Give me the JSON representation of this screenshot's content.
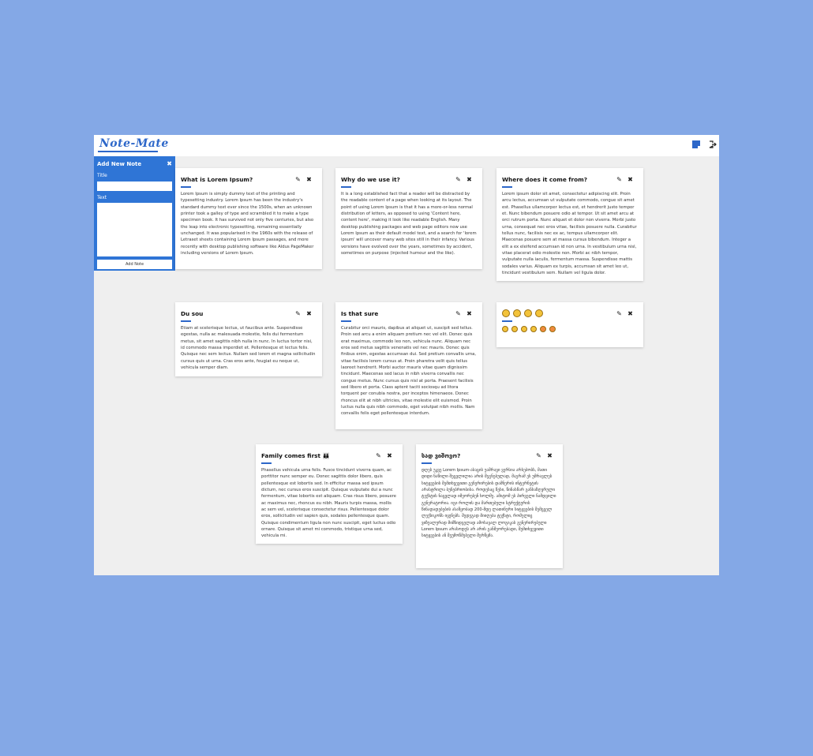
{
  "app": {
    "logo": "Note-Mate",
    "icons": {
      "new_note": "note-icon",
      "logout": "logout-icon"
    }
  },
  "sidebar": {
    "title": "Add New Note",
    "close": "✖",
    "title_label": "Title",
    "text_label": "Text",
    "title_value": "",
    "text_value": "",
    "button_label": "Add Note"
  },
  "icons": {
    "edit": "✎",
    "delete": "✖"
  },
  "notes": [
    {
      "title": "What is Lorem Ipsum?",
      "body": "Lorem Ipsum is simply dummy text of the printing and typesetting industry. Lorem Ipsum has been the industry's standard dummy text ever since the 1500s, when an unknown printer took a galley of type and scrambled it to make a type specimen book. It has survived not only five centuries, but also the leap into electronic typesetting, remaining essentially unchanged. It was popularised in the 1960s with the release of Letraset sheets containing Lorem Ipsum passages, and more recently with desktop publishing software like Aldus PageMaker including versions of Lorem Ipsum."
    },
    {
      "title": "Why do we use it?",
      "body": "It is a long established fact that a reader will be distracted by the readable content of a page when looking at its layout. The point of using Lorem Ipsum is that it has a more-or-less normal distribution of letters, as opposed to using 'Content here, content here', making it look like readable English. Many desktop publishing packages and web page editors now use Lorem Ipsum as their default model text, and a search for 'lorem ipsum' will uncover many web sites still in their infancy. Various versions have evolved over the years, sometimes by accident, sometimes on purpose (injected humour and the like)."
    },
    {
      "title": "Where does it come from?",
      "body": "Lorem ipsum dolor sit amet, consectetur adipiscing elit. Proin arcu lectus, accumsan ut vulputate commodo, congue sit amet est. Phasellus ullamcorper lectus est, et hendrerit justo tempor et. Nunc bibendum posuere odio at tempor. Ut sit amet arcu at orci rutrum porta. Nunc aliquet et dolor non viverra. Morbi justo urna, consequat nec eros vitae, facilisis posuere nulla. Curabitur tellus nunc, facilisis nec ex ac, tempus ullamcorper elit. Maecenas posuere sem at massa cursus bibendum. Integer a elit a ex eleifend accumsan id non urna. In vestibulum urna nisl, vitae placerat odio molestie non. Morbi ac nibh tempor, vulputate nulla iaculis, fermentum massa. Suspendisse mattis sodales varius. Aliquam ex turpis, accumsan sit amet leo ut, tincidunt vestibulum sem. Nullam vel ligula dolor."
    },
    {
      "title": "Du sou",
      "body": "Etiam at scelerisque lectus, ut faucibus ante. Suspendisse egestas, nulla ac malesuada molestie, felis dui fermentum metus, sit amet sagittis nibh nulla in nunc. In luctus tortor nisi, id commodo massa imperdiet et. Pellentesque et lectus felis. Quisque nec sem lectus. Nullam sed lorem et magna sollicitudin cursus quis ut urna. Cras eros ante, feugiat eu neque ut, vehicula semper diam."
    },
    {
      "title": "Is that sure",
      "body": "Curabitur orci mauris, dapibus at aliquet ut, suscipit sed tellus. Proin sed arcu a enim aliquam pretium nec vel elit. Donec quis erat maximus, commodo leo non, vehicula nunc. Aliquam nec eros sed metus sagittis venenatis vel nec mauris. Donec quis finibus enim, egestas accumsan dui. Sed pretium convallis urna, vitae facilisis lorem cursus at. Proin pharetra velit quis tellus laoreet hendrerit. Morbi auctor mauris vitae quam dignissim tincidunt. Maecenas sed lacus in nibh viverra convallis nec congue metus. Nunc cursus quis nisl at porta. Praesent facilisis sed libero et porta. Class aptent taciti sociosqu ad litora torquent per conubia nostra, per inceptos himenaeos. Donec rhoncus elit at nibh ultricies, vitae molestie elit euismod. Proin luctus nulla quis nibh commodo, eget volutpat nibh mollis. Nam convallis felis eget pellentesque interdum."
    },
    {
      "title": "😃 😂 😣 😆",
      "body": "😄 😊 😋 😋 😡 😡"
    },
    {
      "title": "Family comes first 👪",
      "body": "Phasellus vehicula urna felis. Fusce tincidunt viverra quam, ac porttitor nunc semper eu. Donec sagittis dolor libero, quis pellentesque est lobortis sed. In efficitur massa sed ipsum dictum, nec cursus eros suscipit. Quisque vulputate dui a nunc fermentum, vitae lobortis est aliquam. Cras risus libero, posuere ac maximus nec, rhoncus eu nibh. Mauris turpis massa, mollis ac sem vel, scelerisque consectetur risus. Pellentesque dolor eros, sollicitudin vel sapien quis, sodales pellentesque quam. Quisque condimentum ligula non nunc suscipit, eget luctus odio ornare. Quisque sit amet mi commodo, tristique urna sed, vehicula mi."
    },
    {
      "title": "სად ვიშოვო?",
      "body": "დღეს უკვე Lorem Ipsum-ასაცის უამრავი ვერსია არსებობს, მათი დიდი ნაწილი შეცვლილია არის შეგნებულად, მაგრამ ეს უმრავლეს სიტყვების შემთხვევითი გენერირების დამნერის ინტერნეტის არასტრილა ბუნებრიობისა. როდესაც წესი, წინასწარ განსაზღვრული ტექსტის ნაცვლად იმეორებენ ხოლმე. ამიტომ ეს პირველი ნამდვილი გენერატორია. იგი როლის და მართებული სტრუქტურის წინადადებების ასაწყობად 200-მდე ლათინური სიტყვების შემცველ ლექსიკონს იყენებს. შედეგად მიიღება ტექსტი, რომელიც ვიზუალურად მიმზიდველად ამოსავალ ლოგიკას გენერირებული Lorem Ipsum არასოდეს არ არის განმეორებადი, შემთხვევითი სიტყვების ან შეუმოწმებელი შერწყმა."
    }
  ]
}
